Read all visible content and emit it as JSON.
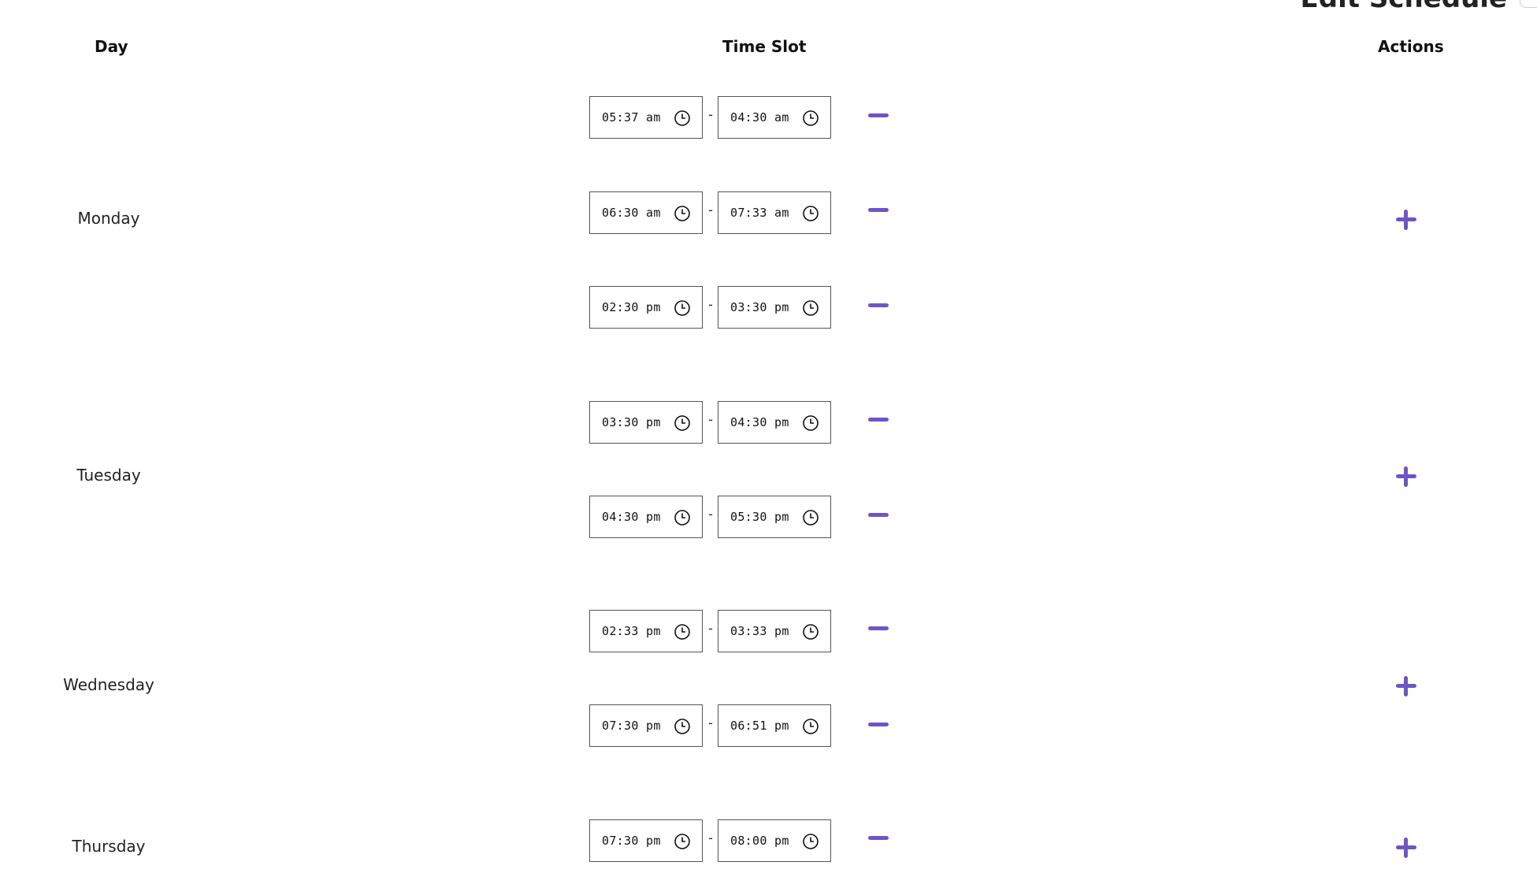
{
  "page": {
    "title": "Edit Schedule"
  },
  "table": {
    "headers": {
      "day": "Day",
      "time_slot": "Time Slot",
      "actions": "Actions"
    },
    "separator": "-"
  },
  "days": [
    {
      "name": "Monday",
      "slots": [
        {
          "start": "05:37 am",
          "end": "04:30 am"
        },
        {
          "start": "06:30 am",
          "end": "07:33 am"
        },
        {
          "start": "02:30 pm",
          "end": "03:30 pm"
        }
      ]
    },
    {
      "name": "Tuesday",
      "slots": [
        {
          "start": "03:30 pm",
          "end": "04:30 pm"
        },
        {
          "start": "04:30 pm",
          "end": "05:30 pm"
        }
      ]
    },
    {
      "name": "Wednesday",
      "slots": [
        {
          "start": "02:33 pm",
          "end": "03:33 pm"
        },
        {
          "start": "07:30 pm",
          "end": "06:51 pm"
        }
      ]
    },
    {
      "name": "Thursday",
      "slots": [
        {
          "start": "07:30 pm",
          "end": "08:00 pm"
        }
      ]
    }
  ],
  "icons": {
    "time_input": "clock-icon",
    "remove": "minus-icon",
    "add": "plus-icon"
  },
  "colors": {
    "accent": "#6f55c4",
    "field_border": "#555555"
  }
}
